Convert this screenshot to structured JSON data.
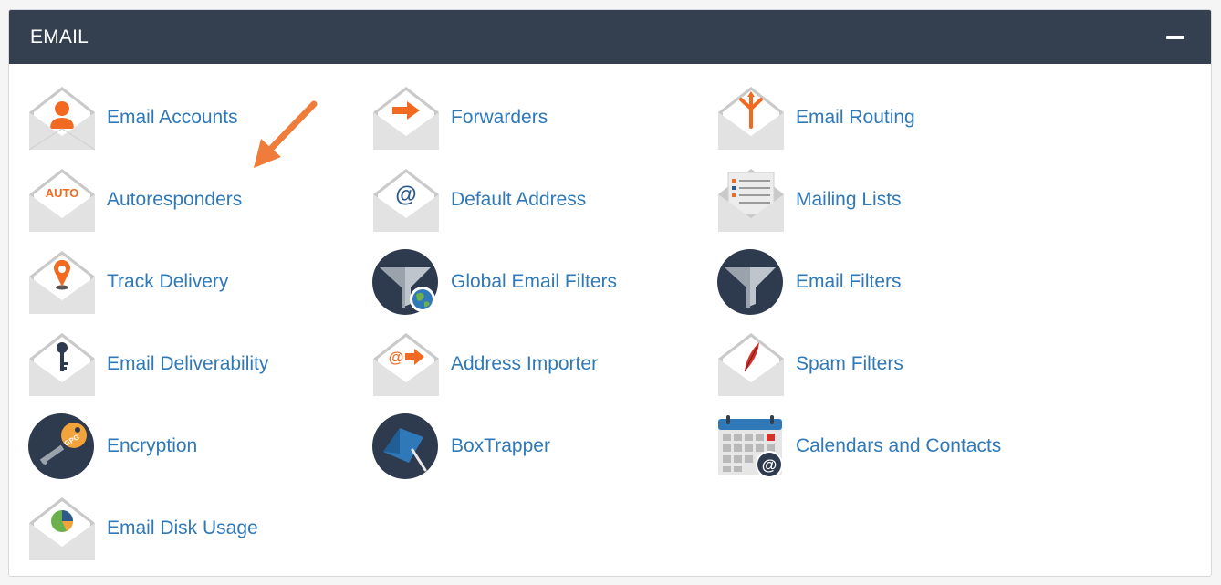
{
  "section": {
    "title": "EMAIL",
    "collapse_icon": "minus-icon"
  },
  "colors": {
    "header_bg": "#34404f",
    "link": "#2f79b9",
    "accent_orange": "#f26a21",
    "envelope_gray": "#d4d4d4",
    "dark_circle": "#2e3a4e"
  },
  "items": [
    {
      "label": "Email Accounts",
      "icon": "email-accounts-icon"
    },
    {
      "label": "Forwarders",
      "icon": "forwarders-icon"
    },
    {
      "label": "Email Routing",
      "icon": "email-routing-icon"
    },
    {
      "label": "Autoresponders",
      "icon": "autoresponders-icon",
      "icon_text": "AUTO"
    },
    {
      "label": "Default Address",
      "icon": "default-address-icon",
      "icon_text": "@"
    },
    {
      "label": "Mailing Lists",
      "icon": "mailing-lists-icon"
    },
    {
      "label": "Track Delivery",
      "icon": "track-delivery-icon"
    },
    {
      "label": "Global Email Filters",
      "icon": "global-email-filters-icon"
    },
    {
      "label": "Email Filters",
      "icon": "email-filters-icon"
    },
    {
      "label": "Email Deliverability",
      "icon": "email-deliverability-icon"
    },
    {
      "label": "Address Importer",
      "icon": "address-importer-icon",
      "icon_text": "@"
    },
    {
      "label": "Spam Filters",
      "icon": "spam-filters-icon"
    },
    {
      "label": "Encryption",
      "icon": "encryption-icon",
      "icon_text": "GPG"
    },
    {
      "label": "BoxTrapper",
      "icon": "boxtrapper-icon"
    },
    {
      "label": "Calendars and Contacts",
      "icon": "calendars-and-contacts-icon",
      "icon_text": "@"
    },
    {
      "label": "Email Disk Usage",
      "icon": "email-disk-usage-icon"
    }
  ],
  "annotation": {
    "icon": "orange-arrow-icon",
    "points_to": "Email Accounts"
  }
}
